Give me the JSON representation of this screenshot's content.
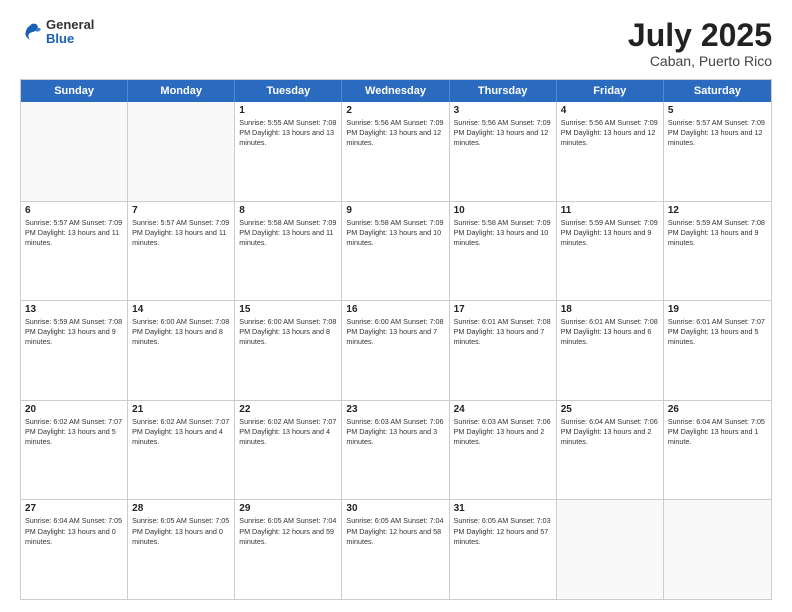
{
  "header": {
    "logo_general": "General",
    "logo_blue": "Blue",
    "month_title": "July 2025",
    "location": "Caban, Puerto Rico"
  },
  "calendar": {
    "days_of_week": [
      "Sunday",
      "Monday",
      "Tuesday",
      "Wednesday",
      "Thursday",
      "Friday",
      "Saturday"
    ],
    "weeks": [
      [
        {
          "day": "",
          "info": ""
        },
        {
          "day": "",
          "info": ""
        },
        {
          "day": "1",
          "info": "Sunrise: 5:55 AM\nSunset: 7:08 PM\nDaylight: 13 hours\nand 13 minutes."
        },
        {
          "day": "2",
          "info": "Sunrise: 5:56 AM\nSunset: 7:09 PM\nDaylight: 13 hours\nand 12 minutes."
        },
        {
          "day": "3",
          "info": "Sunrise: 5:56 AM\nSunset: 7:09 PM\nDaylight: 13 hours\nand 12 minutes."
        },
        {
          "day": "4",
          "info": "Sunrise: 5:56 AM\nSunset: 7:09 PM\nDaylight: 13 hours\nand 12 minutes."
        },
        {
          "day": "5",
          "info": "Sunrise: 5:57 AM\nSunset: 7:09 PM\nDaylight: 13 hours\nand 12 minutes."
        }
      ],
      [
        {
          "day": "6",
          "info": "Sunrise: 5:57 AM\nSunset: 7:09 PM\nDaylight: 13 hours\nand 11 minutes."
        },
        {
          "day": "7",
          "info": "Sunrise: 5:57 AM\nSunset: 7:09 PM\nDaylight: 13 hours\nand 11 minutes."
        },
        {
          "day": "8",
          "info": "Sunrise: 5:58 AM\nSunset: 7:09 PM\nDaylight: 13 hours\nand 11 minutes."
        },
        {
          "day": "9",
          "info": "Sunrise: 5:58 AM\nSunset: 7:09 PM\nDaylight: 13 hours\nand 10 minutes."
        },
        {
          "day": "10",
          "info": "Sunrise: 5:58 AM\nSunset: 7:09 PM\nDaylight: 13 hours\nand 10 minutes."
        },
        {
          "day": "11",
          "info": "Sunrise: 5:59 AM\nSunset: 7:09 PM\nDaylight: 13 hours\nand 9 minutes."
        },
        {
          "day": "12",
          "info": "Sunrise: 5:59 AM\nSunset: 7:08 PM\nDaylight: 13 hours\nand 9 minutes."
        }
      ],
      [
        {
          "day": "13",
          "info": "Sunrise: 5:59 AM\nSunset: 7:08 PM\nDaylight: 13 hours\nand 9 minutes."
        },
        {
          "day": "14",
          "info": "Sunrise: 6:00 AM\nSunset: 7:08 PM\nDaylight: 13 hours\nand 8 minutes."
        },
        {
          "day": "15",
          "info": "Sunrise: 6:00 AM\nSunset: 7:08 PM\nDaylight: 13 hours\nand 8 minutes."
        },
        {
          "day": "16",
          "info": "Sunrise: 6:00 AM\nSunset: 7:08 PM\nDaylight: 13 hours\nand 7 minutes."
        },
        {
          "day": "17",
          "info": "Sunrise: 6:01 AM\nSunset: 7:08 PM\nDaylight: 13 hours\nand 7 minutes."
        },
        {
          "day": "18",
          "info": "Sunrise: 6:01 AM\nSunset: 7:08 PM\nDaylight: 13 hours\nand 6 minutes."
        },
        {
          "day": "19",
          "info": "Sunrise: 6:01 AM\nSunset: 7:07 PM\nDaylight: 13 hours\nand 5 minutes."
        }
      ],
      [
        {
          "day": "20",
          "info": "Sunrise: 6:02 AM\nSunset: 7:07 PM\nDaylight: 13 hours\nand 5 minutes."
        },
        {
          "day": "21",
          "info": "Sunrise: 6:02 AM\nSunset: 7:07 PM\nDaylight: 13 hours\nand 4 minutes."
        },
        {
          "day": "22",
          "info": "Sunrise: 6:02 AM\nSunset: 7:07 PM\nDaylight: 13 hours\nand 4 minutes."
        },
        {
          "day": "23",
          "info": "Sunrise: 6:03 AM\nSunset: 7:06 PM\nDaylight: 13 hours\nand 3 minutes."
        },
        {
          "day": "24",
          "info": "Sunrise: 6:03 AM\nSunset: 7:06 PM\nDaylight: 13 hours\nand 2 minutes."
        },
        {
          "day": "25",
          "info": "Sunrise: 6:04 AM\nSunset: 7:06 PM\nDaylight: 13 hours\nand 2 minutes."
        },
        {
          "day": "26",
          "info": "Sunrise: 6:04 AM\nSunset: 7:05 PM\nDaylight: 13 hours\nand 1 minute."
        }
      ],
      [
        {
          "day": "27",
          "info": "Sunrise: 6:04 AM\nSunset: 7:05 PM\nDaylight: 13 hours\nand 0 minutes."
        },
        {
          "day": "28",
          "info": "Sunrise: 6:05 AM\nSunset: 7:05 PM\nDaylight: 13 hours\nand 0 minutes."
        },
        {
          "day": "29",
          "info": "Sunrise: 6:05 AM\nSunset: 7:04 PM\nDaylight: 12 hours\nand 59 minutes."
        },
        {
          "day": "30",
          "info": "Sunrise: 6:05 AM\nSunset: 7:04 PM\nDaylight: 12 hours\nand 58 minutes."
        },
        {
          "day": "31",
          "info": "Sunrise: 6:05 AM\nSunset: 7:03 PM\nDaylight: 12 hours\nand 57 minutes."
        },
        {
          "day": "",
          "info": ""
        },
        {
          "day": "",
          "info": ""
        }
      ]
    ]
  }
}
